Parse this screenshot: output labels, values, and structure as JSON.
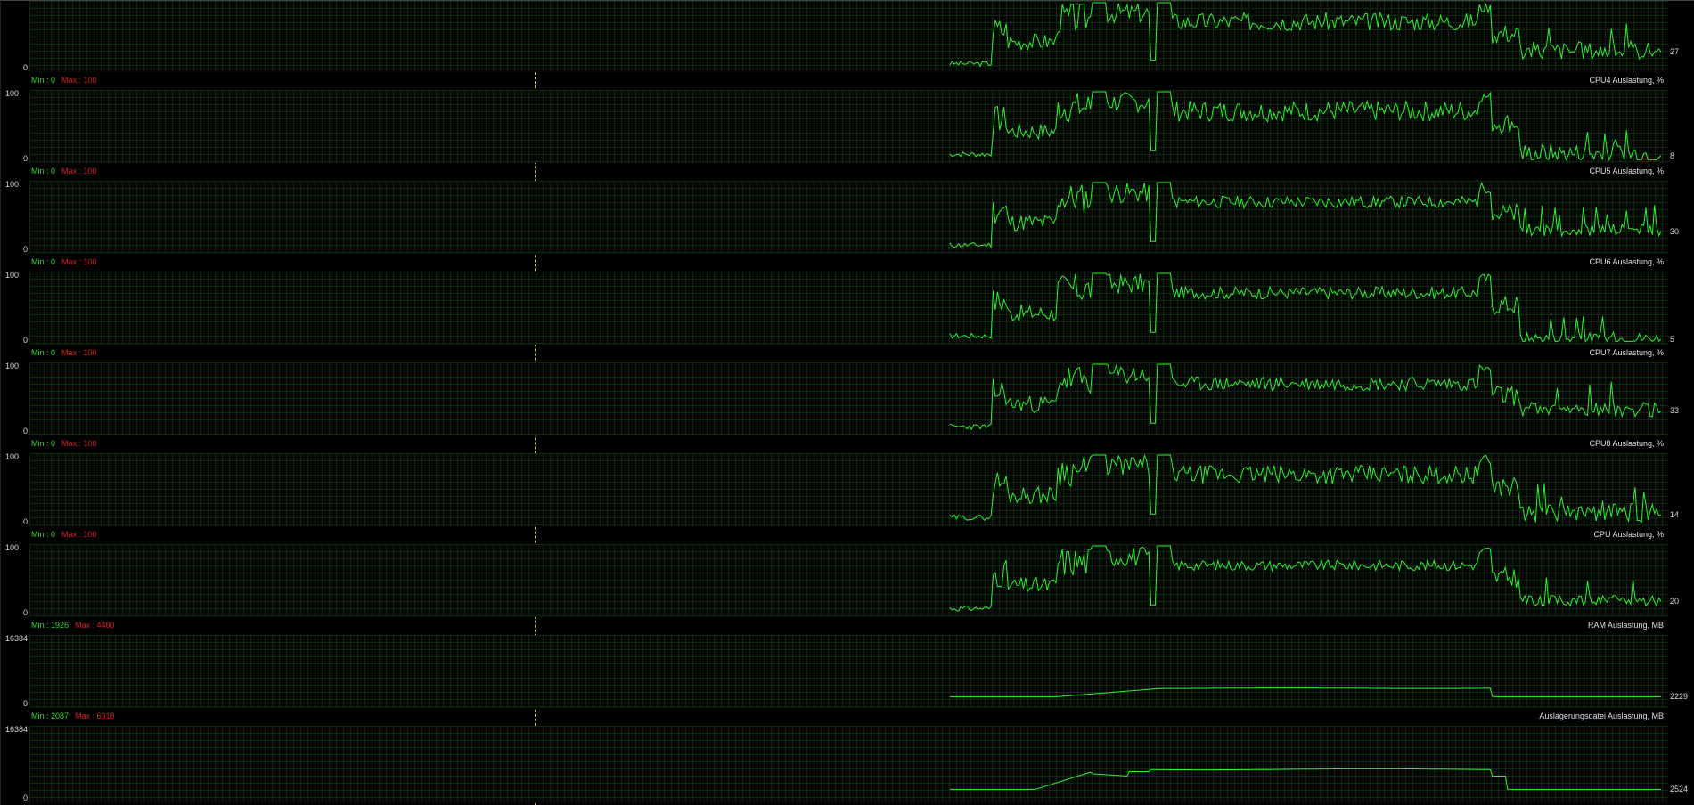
{
  "colors": {
    "background": "#000000",
    "grid": "#0c2a0c",
    "trace": "#2cf42c",
    "min_text": "#30d830",
    "max_text": "#d82020",
    "label_text": "#e0e0e0",
    "cursor": "#e8d020"
  },
  "graphs": [
    {
      "id": "top",
      "axis_max": "",
      "axis_min": "0",
      "current_value": "27",
      "min_label": "Min : 0",
      "max_label": "Max : 100",
      "title": "CPU4 Auslastung, %",
      "range": [
        0,
        100
      ],
      "pattern": "cpu",
      "current": 27,
      "noise": 9,
      "seed": 3
    },
    {
      "id": "cpu4",
      "axis_max": "100",
      "axis_min": "0",
      "current_value": "8",
      "min_label": "Min : 0",
      "max_label": "Max : 100",
      "title": "CPU5 Auslastung, %",
      "range": [
        0,
        100
      ],
      "pattern": "cpu",
      "current": 8,
      "noise": 10,
      "seed": 7
    },
    {
      "id": "cpu5",
      "axis_max": "100",
      "axis_min": "0",
      "current_value": "30",
      "min_label": "Min : 0",
      "max_label": "Max : 100",
      "title": "CPU6 Auslastung, %",
      "range": [
        0,
        100
      ],
      "pattern": "cpu",
      "current": 30,
      "noise": 6,
      "seed": 11
    },
    {
      "id": "cpu6",
      "axis_max": "100",
      "axis_min": "0",
      "current_value": "5",
      "min_label": "Min : 0",
      "max_label": "Max : 100",
      "title": "CPU7 Auslastung, %",
      "range": [
        0,
        100
      ],
      "pattern": "cpu",
      "current": 5,
      "noise": 6,
      "seed": 17
    },
    {
      "id": "cpu7",
      "axis_max": "100",
      "axis_min": "0",
      "current_value": "33",
      "min_label": "Min : 0",
      "max_label": "Max : 100",
      "title": "CPU8 Auslastung, %",
      "range": [
        0,
        100
      ],
      "pattern": "cpu",
      "current": 33,
      "noise": 7,
      "seed": 23
    },
    {
      "id": "cpu8",
      "axis_max": "100",
      "axis_min": "0",
      "current_value": "14",
      "min_label": "Min : 0",
      "max_label": "Max : 100",
      "title": "CPU Auslastung, %",
      "range": [
        0,
        100
      ],
      "pattern": "cpu",
      "current": 14,
      "noise": 9,
      "seed": 29
    },
    {
      "id": "cpu",
      "axis_max": "100",
      "axis_min": "0",
      "current_value": "20",
      "min_label": "Min : 1926",
      "max_label": "Max : 4480",
      "title": "RAM Auslastung, MB",
      "range": [
        0,
        100
      ],
      "pattern": "cpu",
      "current": 20,
      "noise": 5,
      "seed": 31
    },
    {
      "id": "ram",
      "axis_max": "16384",
      "axis_min": "0",
      "current_value": "2229",
      "min_label": "Min : 2087",
      "max_label": "Max : 6018",
      "title": "Auslagerungsdatei Auslastung, MB",
      "range": [
        0,
        16384
      ],
      "pattern": "ram",
      "current": 2229,
      "noise": 0,
      "seed": 37
    },
    {
      "id": "page",
      "axis_max": "16384",
      "axis_min": "0",
      "current_value": "2524",
      "min_label": "",
      "max_label": "",
      "title": "",
      "range": [
        0,
        16384
      ],
      "pattern": "page",
      "current": 2524,
      "noise": 0,
      "seed": 41
    }
  ]
}
